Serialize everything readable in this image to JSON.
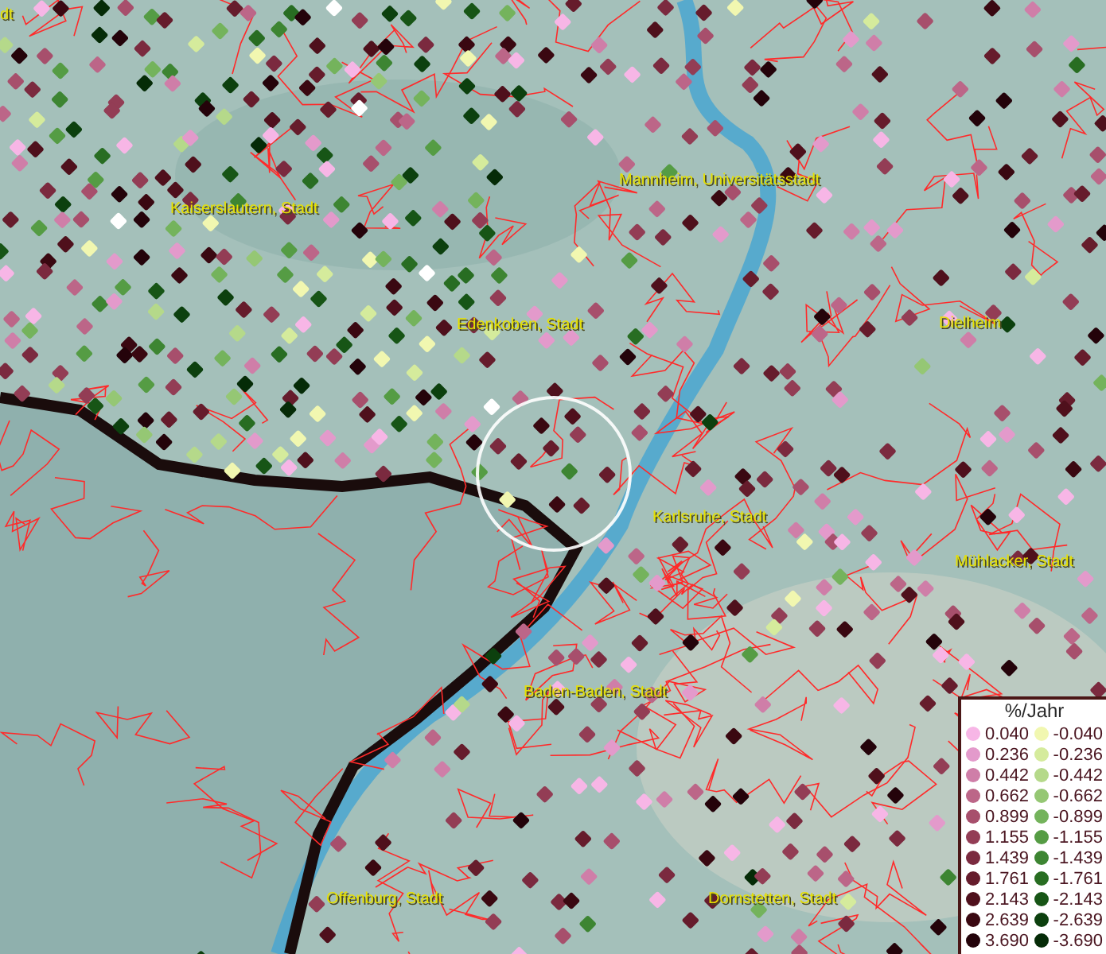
{
  "map": {
    "labels": [
      {
        "text": "dt"
      },
      {
        "text": "Kaiserslautern, Stadt"
      },
      {
        "text": "Mannheim, Universitätsstadt"
      },
      {
        "text": "Edenkoben, Stadt"
      },
      {
        "text": "Dielheim"
      },
      {
        "text": "Karlsruhe, Stadt"
      },
      {
        "text": "Mühlacker, Stadt"
      },
      {
        "text": "Baden-Baden, Stadt"
      },
      {
        "text": "Offenburg, Stadt"
      },
      {
        "text": "Dornstetten, Stadt"
      }
    ]
  },
  "legend": {
    "title": "%/Jahr",
    "positive": [
      {
        "label": "0.040",
        "color": "#f7b6e6"
      },
      {
        "label": "0.236",
        "color": "#e39acb"
      },
      {
        "label": "0.442",
        "color": "#cf7ea8"
      },
      {
        "label": "0.662",
        "color": "#bc6688"
      },
      {
        "label": "0.899",
        "color": "#a74f6c"
      },
      {
        "label": "1.155",
        "color": "#933d55"
      },
      {
        "label": "1.439",
        "color": "#7b2a3f"
      },
      {
        "label": "1.761",
        "color": "#661c2c"
      },
      {
        "label": "2.143",
        "color": "#4f101c"
      },
      {
        "label": "2.639",
        "color": "#3a0811"
      },
      {
        "label": "3.690",
        "color": "#24030a"
      }
    ],
    "negative": [
      {
        "label": "-0.040",
        "color": "#f1f7b0"
      },
      {
        "label": "-0.236",
        "color": "#d5eb9c"
      },
      {
        "label": "-0.442",
        "color": "#b5d98a"
      },
      {
        "label": "-0.662",
        "color": "#95c774"
      },
      {
        "label": "-0.899",
        "color": "#74b35c"
      },
      {
        "label": "-1.155",
        "color": "#559c44"
      },
      {
        "label": "-1.439",
        "color": "#3d8532"
      },
      {
        "label": "-1.761",
        "color": "#286d22"
      },
      {
        "label": "-2.143",
        "color": "#175516"
      },
      {
        "label": "-2.639",
        "color": "#0c400e"
      },
      {
        "label": "-3.690",
        "color": "#052b07"
      }
    ]
  }
}
